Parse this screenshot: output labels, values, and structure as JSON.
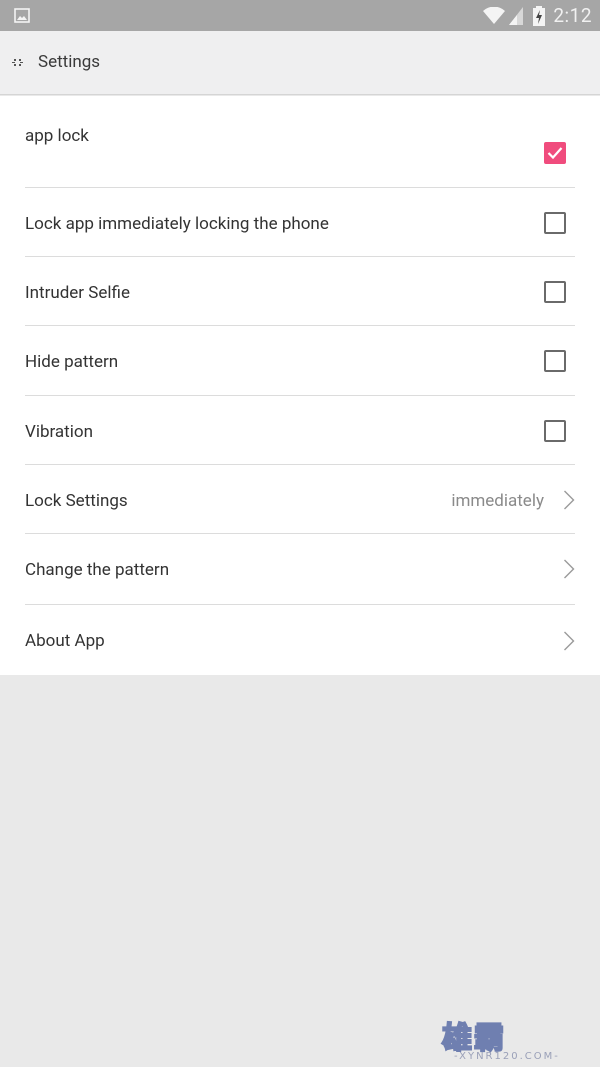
{
  "status_bar": {
    "time": "2:12",
    "icons": [
      "image-notification-icon",
      "wifi-icon",
      "cell-signal-icon",
      "battery-charging-icon"
    ]
  },
  "app_bar": {
    "title": "Settings",
    "back_icon": "back-icon"
  },
  "settings": [
    {
      "label": "app lock",
      "type": "checkbox",
      "checked": true
    },
    {
      "label": "Lock app immediately locking the phone",
      "type": "checkbox",
      "checked": false
    },
    {
      "label": "Intruder Selfie",
      "type": "checkbox",
      "checked": false
    },
    {
      "label": "Hide pattern",
      "type": "checkbox",
      "checked": false
    },
    {
      "label": "Vibration",
      "type": "checkbox",
      "checked": false
    },
    {
      "label": "Lock Settings",
      "type": "link",
      "value": "immediately"
    },
    {
      "label": "Change the pattern",
      "type": "link"
    },
    {
      "label": "About App",
      "type": "link"
    }
  ],
  "colors": {
    "accent": "#f04c7d",
    "status_bar": "#a6a6a6",
    "app_bar": "#efeff0",
    "background": "#e9e9e9"
  },
  "watermark": {
    "text": "雄霸",
    "subtext": "-XYNR120.COM-"
  }
}
